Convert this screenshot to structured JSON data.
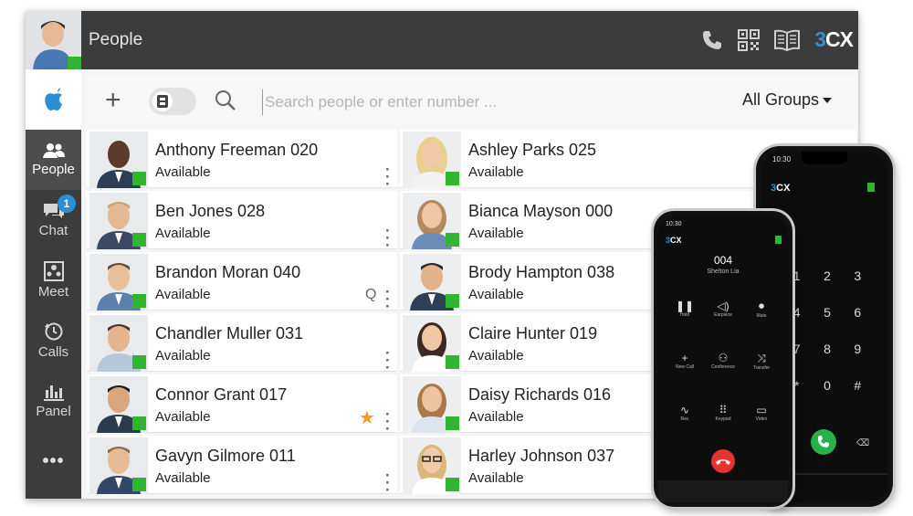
{
  "app": {
    "title": "People",
    "brand": {
      "prefix": "3",
      "suffix": "CX"
    },
    "accent": "#2b8fd6",
    "presence_color": "#2fb52f"
  },
  "sidebar": {
    "items": [
      {
        "label": "People",
        "icon": "people-icon",
        "active": true
      },
      {
        "label": "Chat",
        "icon": "chat-icon",
        "badge": "1"
      },
      {
        "label": "Meet",
        "icon": "meet-icon"
      },
      {
        "label": "Calls",
        "icon": "history-icon"
      },
      {
        "label": "Panel",
        "icon": "panel-icon"
      }
    ],
    "more": "•••"
  },
  "toolbar": {
    "search_placeholder": "Search people or enter number ...",
    "groups_label": "All Groups"
  },
  "contacts_left": [
    {
      "name": "Anthony Freeman 020",
      "status": "Available"
    },
    {
      "name": "Ben Jones 028",
      "status": "Available"
    },
    {
      "name": "Brandon Moran 040",
      "status": "Available",
      "extra": "Q"
    },
    {
      "name": "Chandler Muller 031",
      "status": "Available"
    },
    {
      "name": "Connor Grant 017",
      "status": "Available",
      "extra": "★"
    },
    {
      "name": "Gavyn Gilmore 011",
      "status": "Available"
    }
  ],
  "contacts_right": [
    {
      "name": "Ashley Parks 025",
      "status": "Available"
    },
    {
      "name": "Bianca Mayson 000",
      "status": "Available"
    },
    {
      "name": "Brody Hampton 038",
      "status": "Available"
    },
    {
      "name": "Claire Hunter 019",
      "status": "Available"
    },
    {
      "name": "Daisy Richards 016",
      "status": "Available"
    },
    {
      "name": "Harley Johnson 037",
      "status": "Available"
    }
  ],
  "phone_front": {
    "time": "10:30",
    "ext": "004",
    "caller": "Shelton Lia",
    "buttons": [
      "Hold",
      "Earpiece",
      "Mute",
      "New Call",
      "Conference",
      "Transfer",
      "Rec",
      "Keypad",
      "Video"
    ]
  },
  "phone_back": {
    "time": "10:30",
    "keys": [
      "1",
      "2",
      "3",
      "4",
      "5",
      "6",
      "7",
      "8",
      "9",
      "*",
      "0",
      "#"
    ]
  }
}
